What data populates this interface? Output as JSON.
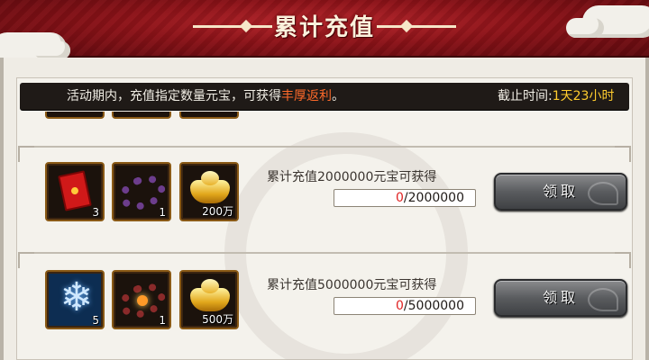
{
  "header": {
    "title": "累计充值"
  },
  "notice": {
    "message_prefix": "活动期内，充值指定数量元宝，可获得",
    "message_highlight": "丰厚返利",
    "message_suffix": "。",
    "deadline_label": "截止时间:",
    "deadline_value": "1天23小时"
  },
  "tiers": [
    {
      "requirement": "累计充值2000000元宝可获得",
      "progress_current": "0",
      "progress_target": "/2000000",
      "claim_label": "领取",
      "rewards": [
        {
          "icon": "red-packet-icon",
          "count": "3"
        },
        {
          "icon": "bead-bracelet-icon",
          "count": "1"
        },
        {
          "icon": "gold-ingot-icon",
          "count": "200万"
        }
      ]
    },
    {
      "requirement": "累计充值5000000元宝可获得",
      "progress_current": "0",
      "progress_target": "/5000000",
      "claim_label": "领取",
      "rewards": [
        {
          "icon": "snowflake-icon",
          "count": "5"
        },
        {
          "icon": "gem-bracelet-icon",
          "count": "1"
        },
        {
          "icon": "gold-ingot-icon",
          "count": "500万"
        }
      ]
    }
  ],
  "colors": {
    "banner_red": "#8c1218",
    "highlight_orange": "#ff6a2a",
    "deadline_yellow": "#ffcc2e",
    "progress_current_red": "#e02222"
  }
}
